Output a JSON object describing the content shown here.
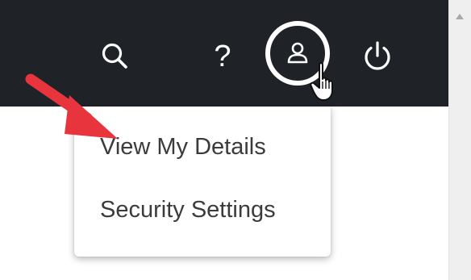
{
  "header": {
    "icons": {
      "search": "search-icon",
      "help": "help-icon",
      "help_glyph": "?",
      "user": "user-icon",
      "power": "power-icon"
    }
  },
  "dropdown": {
    "items": [
      {
        "label": "View My Details"
      },
      {
        "label": "Security Settings"
      }
    ]
  },
  "colors": {
    "topbar": "#1f2328",
    "annotation_arrow": "#e8343c",
    "menu_text": "#3b3b3b"
  }
}
